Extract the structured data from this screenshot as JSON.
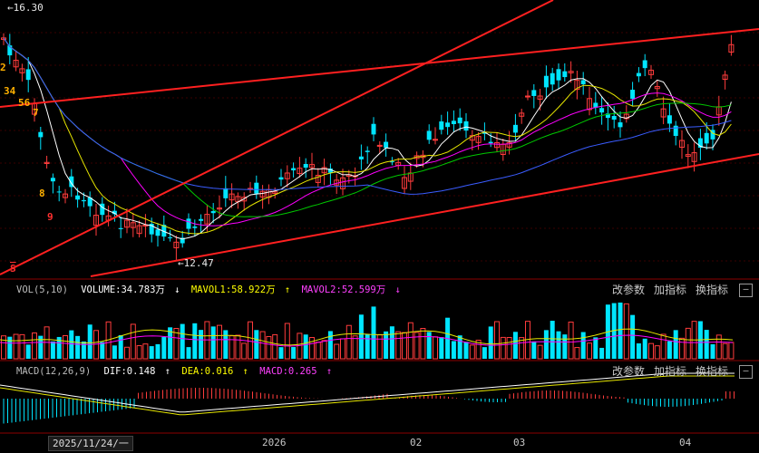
{
  "price_panel": {
    "high_marker": "←16.30",
    "low_marker": "←12.47",
    "td_counts": [
      "2",
      "34",
      "56",
      "7",
      "8",
      "9"
    ],
    "s_marker": "S"
  },
  "vol_panel": {
    "name": "VOL(5,10)",
    "volume": "VOLUME:34.783万",
    "mavol1": "MAVOL1:58.922万",
    "mavol2": "MAVOL2:52.599万",
    "arrow_volume": "↓",
    "arrow_mavol1": "↑",
    "arrow_mavol2": "↓"
  },
  "macd_panel": {
    "name": "MACD(12,26,9)",
    "dif": "DIF:0.148",
    "dea": "DEA:0.016",
    "macd": "MACD:0.265",
    "arrow_dif": "↑",
    "arrow_dea": "↑",
    "arrow_macd": "↑"
  },
  "panel_buttons": {
    "change_params": "改参数",
    "add_indicator": "加指标",
    "switch_indicator": "换指标",
    "close": "—"
  },
  "x_axis": {
    "cursor_date": "2025/11/24/一",
    "labels": [
      "2026",
      "02",
      "03",
      "04"
    ]
  },
  "colors": {
    "up": "#ff3c3c",
    "down": "#00e5ff",
    "trendline": "#ff2020",
    "ma_white": "#ffffff",
    "ma_yellow": "#e6e600",
    "ma_magenta": "#ff00ff",
    "ma_green": "#00c800",
    "ma_blue": "#3a5cff",
    "volume_label": "#ffffff",
    "mavol1_label": "#ffff00",
    "mavol2_label": "#ff40ff"
  },
  "chart_data": {
    "type": "candlestick",
    "indicators": [
      "VOL(5,10)",
      "MACD(12,26,9)"
    ],
    "price_high": 16.3,
    "price_low": 12.47,
    "x_labels": [
      "2025/11/24/一",
      "2026",
      "02",
      "03",
      "04"
    ],
    "volume": {
      "VOLUME": "34.783万",
      "MAVOL1": "58.922万",
      "MAVOL2": "52.599万"
    },
    "macd": {
      "DIF": 0.148,
      "DEA": 0.016,
      "MACD": 0.265
    }
  }
}
